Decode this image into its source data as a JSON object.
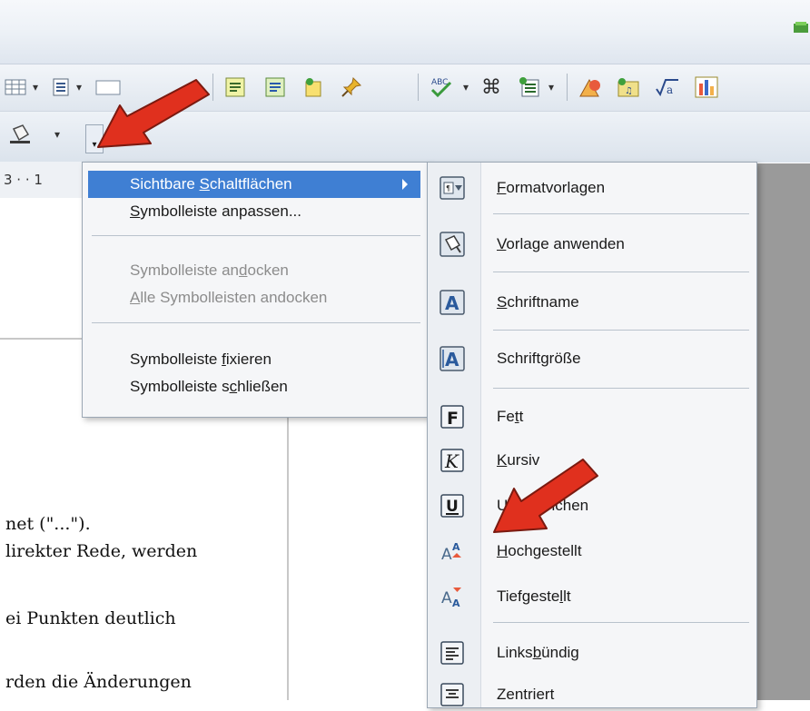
{
  "document_lines": [
    "net (\"...\").",
    "lirekter Rede, werden",
    "ei Punkten deutlich",
    "rden die Änderungen"
  ],
  "ruler_text": "3 · · 1",
  "menu": {
    "items": [
      {
        "pre": "Sichtbare ",
        "ul": "S",
        "post": "chaltflächen"
      },
      {
        "pre": "",
        "ul": "S",
        "post": "ymbolleiste anpassen..."
      },
      {
        "pre": "Symbolleiste an",
        "ul": "d",
        "post": "ocken"
      },
      {
        "pre": "",
        "ul": "A",
        "post": "lle Symbolleisten andocken"
      },
      {
        "pre": "Symbolleiste ",
        "ul": "f",
        "post": "ixieren"
      },
      {
        "pre": "Symbolleiste s",
        "ul": "c",
        "post": "hließen"
      }
    ]
  },
  "submenu": {
    "items": [
      {
        "pre": "",
        "ul": "F",
        "post": "ormatvorlagen",
        "icon": "styles-icon"
      },
      {
        "pre": "",
        "ul": "V",
        "post": "orlage anwenden",
        "icon": "apply-style-icon"
      },
      {
        "pre": "",
        "ul": "S",
        "post": "chriftname",
        "icon": "font-name-icon"
      },
      {
        "pre": "Schrift",
        "ul": "g",
        "post": "röße",
        "icon": "font-size-icon"
      },
      {
        "pre": "Fe",
        "ul": "t",
        "post": "t",
        "icon": "bold-icon"
      },
      {
        "pre": "",
        "ul": "K",
        "post": "ursiv",
        "icon": "italic-icon"
      },
      {
        "pre": "U",
        "ul": "",
        "post": "nterstrichen",
        "icon": "underline-icon"
      },
      {
        "pre": "",
        "ul": "H",
        "post": "ochgestellt",
        "icon": "superscript-icon"
      },
      {
        "pre": "Tiefgeste",
        "ul": "l",
        "post": "lt",
        "icon": "subscript-icon"
      },
      {
        "pre": "Links",
        "ul": "b",
        "post": "ündig",
        "icon": "align-left-icon"
      },
      {
        "pre": "Zentriert",
        "ul": "",
        "post": "",
        "icon": "align-center-icon"
      }
    ]
  },
  "colors": {
    "highlight": "#3f7fd3",
    "arrow": "#e0301e"
  }
}
